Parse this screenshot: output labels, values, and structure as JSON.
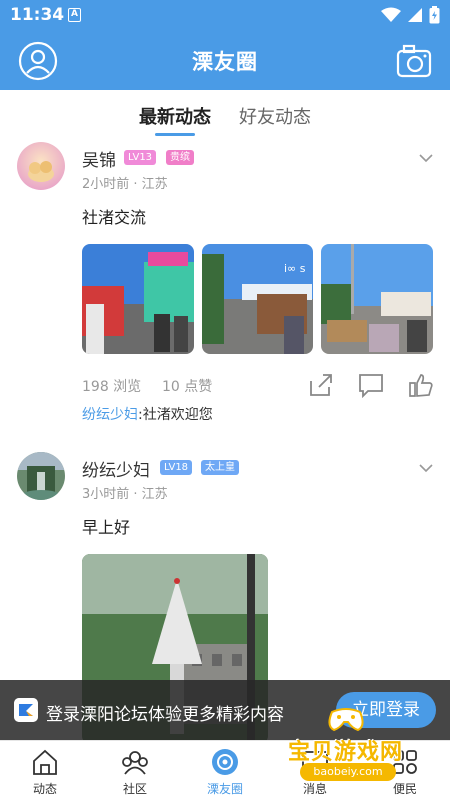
{
  "status_bar": {
    "time": "11:34",
    "notification_glyph": "A"
  },
  "app_bar": {
    "title": "溧友圈"
  },
  "tabs": [
    {
      "label": "最新动态",
      "active": true
    },
    {
      "label": "好友动态",
      "active": false
    }
  ],
  "posts": [
    {
      "user": "吴锦",
      "level": "LV13",
      "title_badge": "贵缤",
      "meta": "2小时前 · 江苏",
      "content": "社渚交流",
      "views": "198 浏览",
      "likes": "10 点赞",
      "comment": {
        "author": "纷纭少妇",
        "text": ":社渚欢迎您"
      }
    },
    {
      "user": "纷纭少妇",
      "level": "LV18",
      "title_badge": "太上皇",
      "meta": "3小时前 · 江苏",
      "content": "早上好"
    }
  ],
  "login_banner": {
    "text": "登录溧阳论坛体验更多精彩内容",
    "button": "立即登录"
  },
  "bottom_nav": [
    {
      "label": "动态",
      "icon": "home-icon"
    },
    {
      "label": "社区",
      "icon": "community-icon"
    },
    {
      "label": "溧友圈",
      "icon": "circle-icon",
      "active": true
    },
    {
      "label": "消息",
      "icon": "message-icon"
    },
    {
      "label": "便民",
      "icon": "service-icon"
    }
  ],
  "watermark": {
    "text": "宝贝游戏网",
    "url": "baobeiy.com"
  },
  "colors": {
    "accent": "#4a9be6",
    "level_badge": "#f08ad8",
    "title_badge_pink": "#f07ec8",
    "title_badge_blue": "#6fa8f5"
  }
}
